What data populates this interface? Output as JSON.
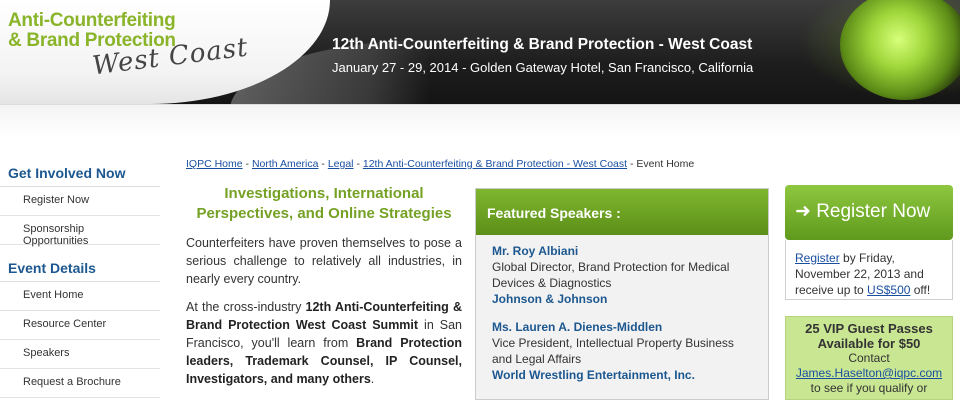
{
  "header": {
    "logo_line1": "Anti-Counterfeiting",
    "logo_line2": "& Brand Protection",
    "logo_script": "West Coast",
    "event_title": "12th Anti-Counterfeiting & Brand Protection - West Coast",
    "event_subtitle": "January 27 - 29, 2014 - Golden Gateway Hotel, San Francisco, California"
  },
  "sidebar": {
    "section1_title": "Get Involved Now",
    "section1_items": [
      "Register Now",
      "Sponsorship Opportunities"
    ],
    "section2_title": "Event Details",
    "section2_items": [
      "Event Home",
      "Resource Center",
      "Speakers",
      "Request a Brochure"
    ]
  },
  "breadcrumb": {
    "links": [
      "IQPC Home",
      "North America",
      "Legal",
      "12th Anti-Counterfeiting & Brand Protection - West Coast"
    ],
    "separator": "-",
    "current": "Event Home"
  },
  "main": {
    "heading": "Investigations, International Perspectives, and Online Strategies",
    "para1": "Counterfeiters have proven themselves to pose a serious challenge to relatively all industries, in nearly every country.",
    "para2_pre": "At the cross-industry ",
    "para2_bold1": "12th Anti-Counterfeiting & Brand Protection West Coast Summit",
    "para2_mid": " in San Francisco, you'll learn from ",
    "para2_bold2": "Brand Protection leaders, Trademark Counsel, IP Counsel, Investigators, and many others",
    "para2_end": "."
  },
  "speakers": {
    "title": "Featured Speakers :",
    "list": [
      {
        "name": "Mr. Roy Albiani",
        "role": "Global Director, Brand Protection for Medical Devices & Diagnostics",
        "org": "Johnson & Johnson"
      },
      {
        "name": "Ms. Lauren A. Dienes-Middlen",
        "role": "Vice President, Intellectual Property Business and Legal Affairs",
        "org": "World Wrestling Entertainment, Inc."
      }
    ]
  },
  "register": {
    "button_label": "➜ Register Now",
    "link_text": "Register",
    "text_mid": " by Friday, November 22, 2013 and receive up to ",
    "amount": "US$500",
    "text_end": " off!"
  },
  "vip": {
    "title": "25 VIP Guest Passes Available for $50",
    "contact_label": "Contact",
    "email": "James.Haselton@iqpc.com",
    "tail": "to see if you qualify or"
  },
  "colors": {
    "accent_green": "#75a125",
    "link_blue": "#1a4fa0",
    "nav_blue": "#1c5790"
  }
}
